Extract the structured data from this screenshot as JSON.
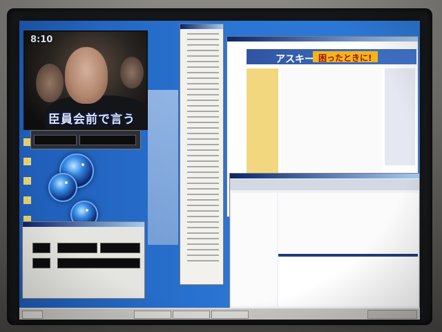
{
  "photo": {
    "subject": "Photo of a CRT monitor showing a Windows desktop with multiple windows",
    "colors": {
      "desktop": "#2b76d4",
      "bezel": "#1b1c1f",
      "web_header": "#2f55a2",
      "promo": "#f3b51b"
    }
  },
  "video": {
    "clock": "8:10",
    "caption": "臣員会前で言うのは"
  },
  "web": {
    "brand": "アスキー",
    "promo": "困ったときに!"
  }
}
